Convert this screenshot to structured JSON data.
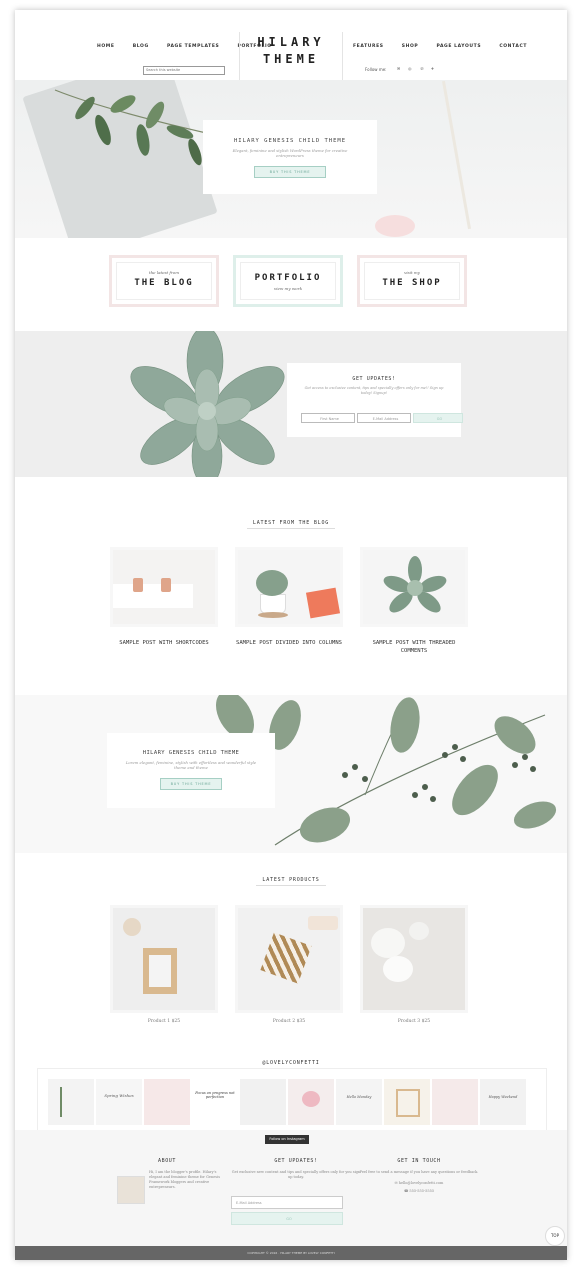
{
  "nav": {
    "left": [
      "HOME",
      "BLOG",
      "PAGE TEMPLATES",
      "PORTFOLIO"
    ],
    "right": [
      "FEATURES",
      "SHOP",
      "PAGE LAYOUTS",
      "CONTACT"
    ]
  },
  "logo": {
    "line1": "HILARY",
    "line2": "THEME"
  },
  "search": {
    "placeholder": "Search this website"
  },
  "follow": {
    "label": "Follow me:"
  },
  "hero": {
    "title": "HILARY GENESIS CHILD THEME",
    "subtitle": "Elegant, feminine and stylish WordPress theme for creative entrepreneurs",
    "button": "BUY THIS THEME"
  },
  "categories": [
    {
      "small": "the latest from",
      "big": "THE BLOG"
    },
    {
      "small": "view my work",
      "big": "PORTFOLIO"
    },
    {
      "small": "visit my",
      "big": "THE SHOP"
    }
  ],
  "newsletter": {
    "title": "GET UPDATES!",
    "text": "Get access to exclusive content, tips and specially offers only for me!! Sign up today! Signup!",
    "first_name": "First Name",
    "email": "E-Mail Address",
    "button": "GO"
  },
  "blog": {
    "heading": "LATEST FROM THE BLOG",
    "posts": [
      {
        "title": "SAMPLE POST WITH SHORTCODES"
      },
      {
        "title": "SAMPLE POST DIVIDED INTO COLUMNS"
      },
      {
        "title": "SAMPLE POST WITH THREADED COMMENTS"
      }
    ]
  },
  "promo": {
    "title": "HILARY GENESIS CHILD THEME",
    "text": "Lorem elegant, feminine, stylish with effortless and wonderful style theme and theme",
    "button": "BUY THIS THEME"
  },
  "products": {
    "heading": "LATEST PRODUCTS",
    "items": [
      {
        "name": "Product 1 $25"
      },
      {
        "name": "Product 2 $35"
      },
      {
        "name": "Product 3 $25"
      }
    ]
  },
  "instagram": {
    "handle": "@LOVELYCONFETTI",
    "button": "Follow on Instagram",
    "tile_texts": [
      "Spring Wishes",
      "",
      "Focus on progress not perfection",
      "",
      "",
      "Hello Monday",
      "",
      "",
      "",
      "Happy Weekend"
    ]
  },
  "footer": {
    "about": {
      "title": "ABOUT",
      "text": "Hi, I am the blogger's profile. Hilary's elegant and feminine theme for Genesis Framework bloggers and creative entrepreneurs."
    },
    "updates": {
      "title": "GET UPDATES!",
      "text": "Get exclusive new content and tips and specially offers only for you sign up today.",
      "email": "E-Mail Address",
      "button": "GO"
    },
    "touch": {
      "title": "GET IN TOUCH",
      "text": "Feel free to send a message if you have any questions or feedback.",
      "email": "hello@lovelyconfetti.com",
      "phone": "555-555-5555"
    }
  },
  "bottom": {
    "text": "COPYRIGHT © 2016 · HILARY THEME BY LOVELY CONFETTI",
    "totop": "TOP"
  }
}
